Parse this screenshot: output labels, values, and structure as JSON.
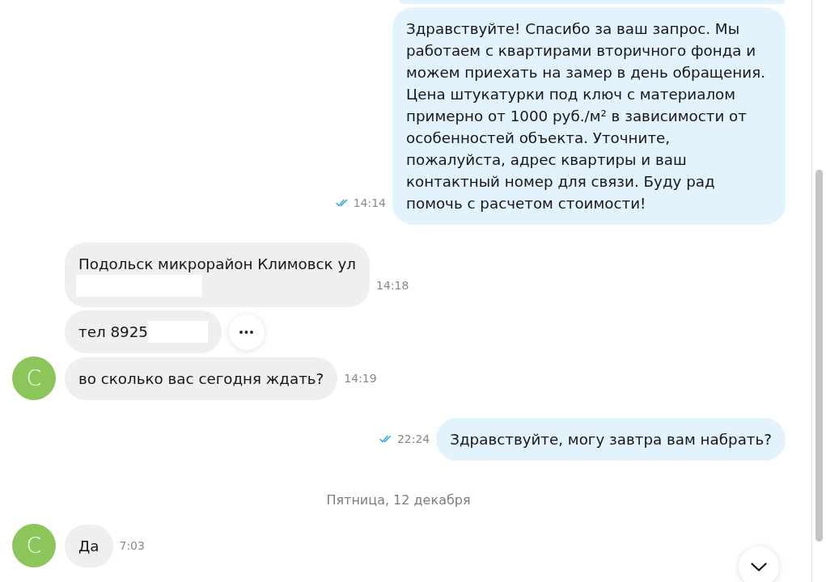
{
  "messages": [
    {
      "kind": "outgoing",
      "clipped": true
    },
    {
      "kind": "outgoing",
      "text": "Здравствуйте! Спасибо за ваш запрос. Мы работаем с квартирами вторичного фонда и можем приехать на замер в день обращения. Цена штукатурки под ключ с материалом примерно от 1000 руб./м² в зависимости от особенностей объекта. Уточните,\nпожалуйста, адрес квартиры и ваш контактный номер для связи. Буду рад помочь с расчетом стоимости!",
      "time": "14:14",
      "read": true
    },
    {
      "kind": "incoming",
      "text": "Подольск микрорайон Климовск ул",
      "redaction": {
        "kind": "line"
      },
      "time": "14:18"
    },
    {
      "kind": "incoming",
      "text": "тел 8925",
      "redaction": {
        "kind": "inline"
      },
      "show_actions": true
    },
    {
      "kind": "incoming",
      "text": "во сколько вас сегодня ждать?",
      "time": "14:19",
      "avatar": {
        "letter": "С",
        "color": "#8cc55a"
      }
    },
    {
      "kind": "outgoing",
      "text": "Здравствуйте, могу завтра вам набрать?",
      "time": "22:24",
      "read": true
    },
    {
      "kind": "date_separator",
      "text": "Пятница, 12 декабря"
    },
    {
      "kind": "incoming",
      "text": "Да",
      "time": "7:03",
      "avatar": {
        "letter": "С",
        "color": "#8cc55a"
      }
    }
  ],
  "scroll_down_button": true
}
